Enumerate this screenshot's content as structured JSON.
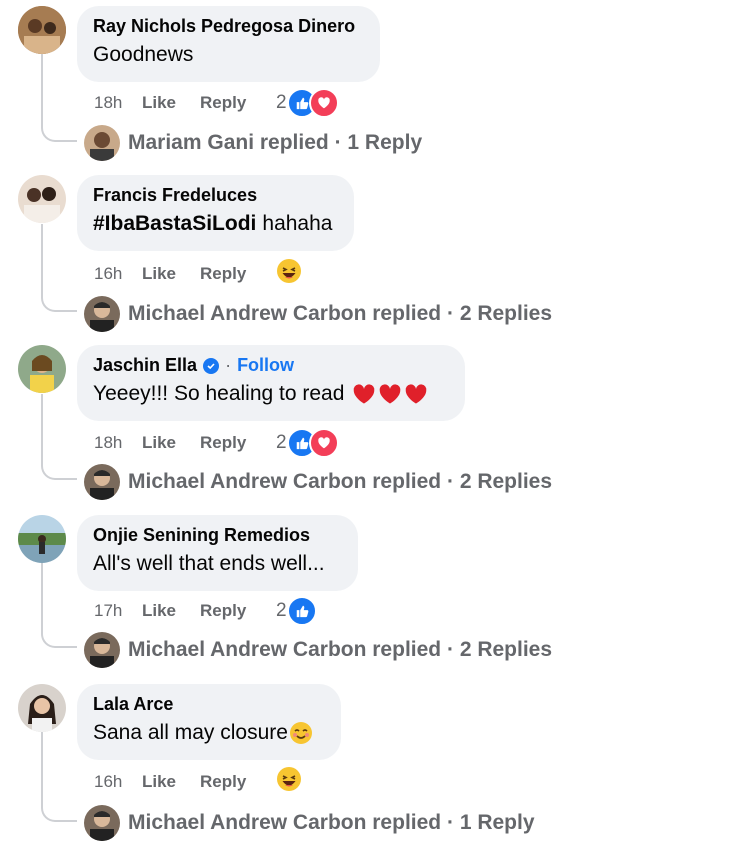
{
  "comments": [
    {
      "author": "Ray Nichols Pedregosa Dinero",
      "text": "Goodnews",
      "time": "18h",
      "like_label": "Like",
      "reply_label": "Reply",
      "reaction_count": "2",
      "reactions": [
        "like-icon",
        "love-icon"
      ],
      "replied_by": "Mariam Gani replied",
      "reply_count": "1 Reply"
    },
    {
      "author": "Francis Fredeluces",
      "hashtag": "#IbaBastaSiLodi",
      "text": "hahaha",
      "time": "16h",
      "like_label": "Like",
      "reply_label": "Reply",
      "reactions": [
        "haha-icon"
      ],
      "replied_by": "Michael Andrew Carbon replied",
      "reply_count": "2 Replies"
    },
    {
      "author": "Jaschin Ella",
      "follow_label": "Follow",
      "text": "Yeeey!!! So healing to read",
      "text_emoji": "heart-icons",
      "time": "18h",
      "like_label": "Like",
      "reply_label": "Reply",
      "reaction_count": "2",
      "reactions": [
        "like-icon",
        "love-icon"
      ],
      "replied_by": "Michael Andrew Carbon replied",
      "reply_count": "2 Replies"
    },
    {
      "author": "Onjie Senining Remedios",
      "text": "All's well that ends well...",
      "time": "17h",
      "like_label": "Like",
      "reply_label": "Reply",
      "reaction_count": "2",
      "reactions": [
        "like-icon"
      ],
      "replied_by": "Michael Andrew Carbon replied",
      "reply_count": "2 Replies"
    },
    {
      "author": "Lala Arce",
      "text": "Sana all may closure",
      "text_emoji": "smiling-face-icon",
      "time": "16h",
      "like_label": "Like",
      "reply_label": "Reply",
      "reactions": [
        "haha-icon"
      ],
      "replied_by": "Michael Andrew Carbon replied",
      "reply_count": "1 Reply"
    }
  ],
  "separator": "·",
  "colors": {
    "accent": "#1877f2",
    "love": "#f33e58",
    "bubble": "#f0f2f5",
    "muted": "#65676b"
  }
}
